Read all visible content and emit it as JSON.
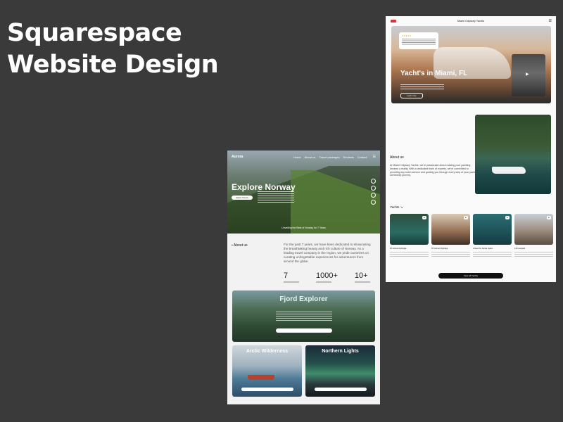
{
  "title": {
    "line1": "Squarespace",
    "line2": "Website Design"
  },
  "norway": {
    "nav": {
      "logo": "Aurora",
      "links": [
        "Home",
        "About us",
        "Travel packages",
        "Reviews",
        "Contact"
      ],
      "menu_icon": "menu-icon"
    },
    "hero": {
      "heading": "Explore Norway",
      "button": "Explore Norway",
      "since": "Unveiling the Best of Norway for 7 Years",
      "social_icons": [
        "instagram-icon",
        "youtube-icon",
        "linkedin-icon",
        "twitter-icon"
      ]
    },
    "about": {
      "label": "About us",
      "text": "For the past 7 years, we have been dedicated to showcasing the breathtaking beauty and rich culture of Norway. As a leading travel company in the region, we pride ourselves on curating unforgettable experiences for adventurers from around the globe.",
      "stats": [
        {
          "value": "7"
        },
        {
          "value": "1000+"
        },
        {
          "value": "10+"
        }
      ]
    },
    "cards": [
      {
        "title": "Fjord Explorer"
      },
      {
        "title": "Arctic Wilderness"
      },
      {
        "title": "Northern Lights"
      }
    ]
  },
  "miami": {
    "nav": {
      "brand": "Miami Odyssey Yachts",
      "menu_icon": "menu-icon"
    },
    "hero": {
      "stars": "★★★★★",
      "heading": "Yacht's in Miami, FL",
      "button": "Learn more",
      "play_icon": "play-icon"
    },
    "about": {
      "label": "About us",
      "text": "At Miami Odyssey Yachts, we're passionate about making your yachting dreams a reality. With a dedicated team of experts, we're committed to providing top-notch service and guiding you through every step of your yacht ownership journey."
    },
    "yachts": {
      "label": "Yachts ↘",
      "items": [
        {
          "name": "65' Azimut Flybridge"
        },
        {
          "name": "55' Azimut Flybridge"
        },
        {
          "name": "2 New Pro Series Hydra"
        },
        {
          "name": "120' Leopard"
        }
      ],
      "cta": "View all Yachts"
    }
  }
}
